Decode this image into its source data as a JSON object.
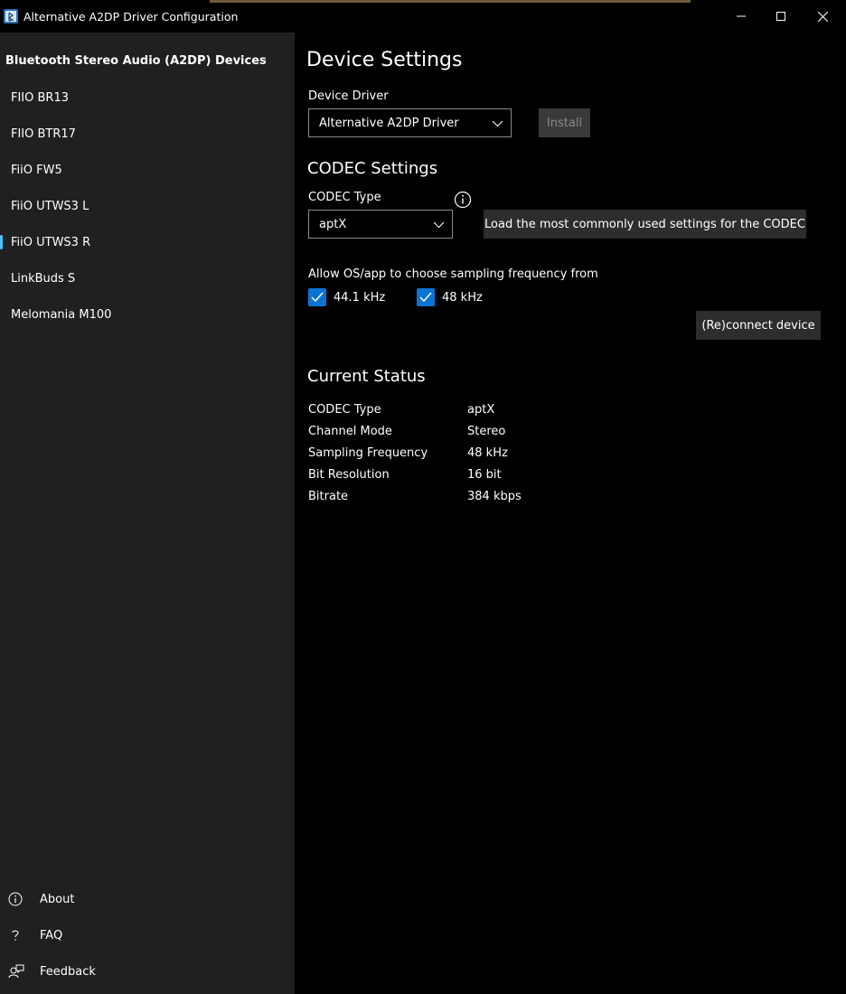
{
  "window": {
    "title": "Alternative A2DP Driver Configuration",
    "accent": "#4cc2ff",
    "checkbox_color": "#0a74d6"
  },
  "sidebar": {
    "header": "Bluetooth Stereo Audio (A2DP) Devices",
    "items": [
      {
        "label": "FIIO BR13"
      },
      {
        "label": "FIIO BTR17"
      },
      {
        "label": "FiiO FW5"
      },
      {
        "label": "FiiO UTWS3 L"
      },
      {
        "label": "FiiO UTWS3 R",
        "selected": true
      },
      {
        "label": "LinkBuds S"
      },
      {
        "label": "Melomania M100"
      }
    ],
    "footer": [
      {
        "label": "About",
        "icon": "info-icon"
      },
      {
        "label": "FAQ",
        "icon": "question-icon"
      },
      {
        "label": "Feedback",
        "icon": "feedback-icon"
      }
    ]
  },
  "main": {
    "title": "Device Settings",
    "device_driver": {
      "label": "Device Driver",
      "value": "Alternative A2DP Driver",
      "install_label": "Install"
    },
    "codec_settings": {
      "title": "CODEC Settings",
      "codec_type_label": "CODEC Type",
      "codec_type_value": "aptX",
      "load_button": "Load the most commonly used settings for the CODEC",
      "sampling_label": "Allow OS/app to choose sampling frequency from",
      "freq_options": [
        {
          "label": "44.1 kHz",
          "checked": true
        },
        {
          "label": "48 kHz",
          "checked": true
        }
      ],
      "reconnect_button": "(Re)connect device"
    },
    "status": {
      "title": "Current Status",
      "rows": [
        {
          "key": "CODEC Type",
          "value": "aptX"
        },
        {
          "key": "Channel Mode",
          "value": "Stereo"
        },
        {
          "key": "Sampling Frequency",
          "value": "48 kHz"
        },
        {
          "key": "Bit Resolution",
          "value": "16 bit"
        },
        {
          "key": "Bitrate",
          "value": "384 kbps"
        }
      ]
    }
  }
}
